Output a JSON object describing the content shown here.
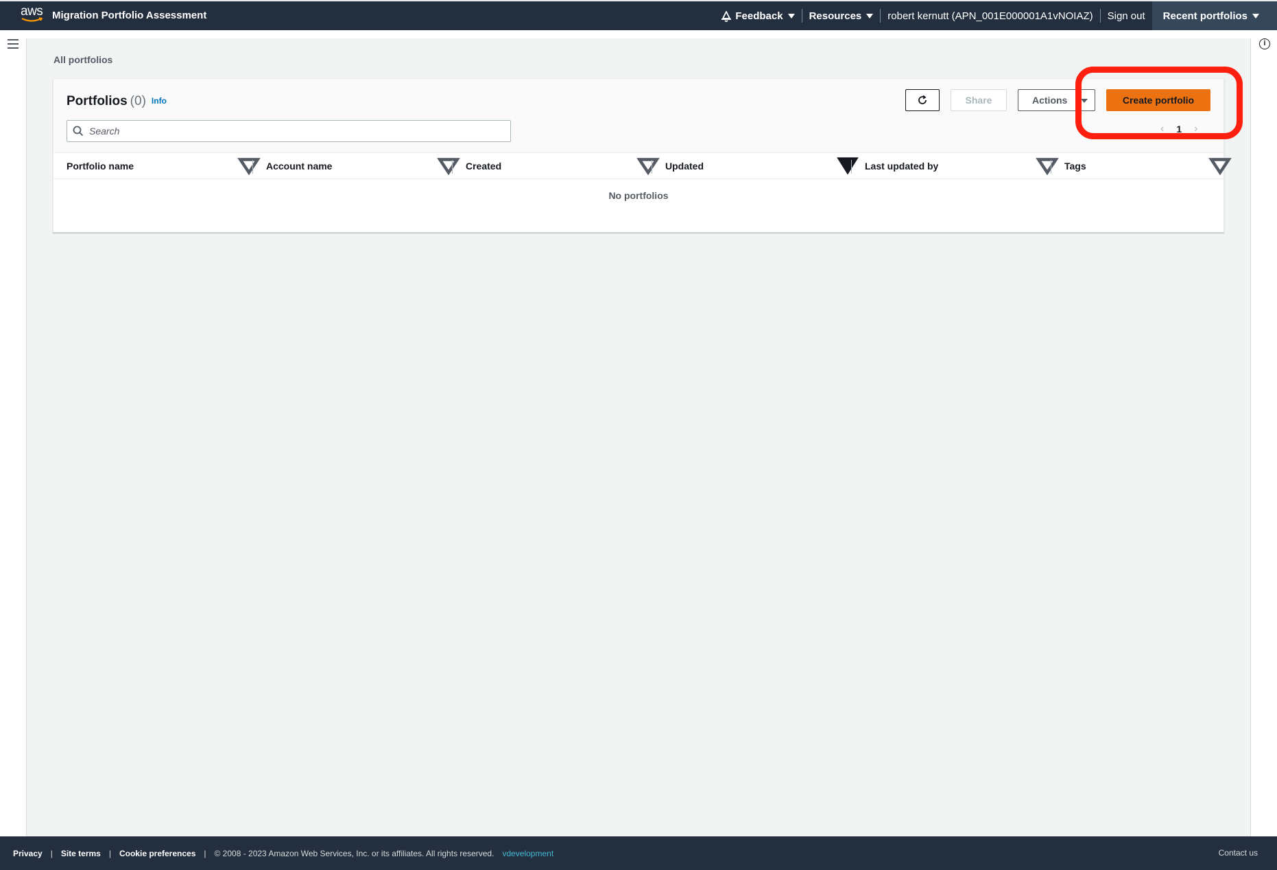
{
  "topnav": {
    "logo_text": "aws",
    "app_title": "Migration Portfolio Assessment",
    "feedback_label": "Feedback",
    "resources_label": "Resources",
    "user_label": "robert kernutt (APN_001E000001A1vNOIAZ)",
    "signout_label": "Sign out",
    "recent_label": "Recent portfolios"
  },
  "breadcrumb": "All portfolios",
  "portfolios": {
    "title": "Portfolios",
    "count": "(0)",
    "info_label": "Info",
    "search_placeholder": "Search",
    "share_label": "Share",
    "actions_label": "Actions",
    "create_label": "Create portfolio",
    "page_number": "1",
    "empty_text": "No portfolios",
    "columns": [
      "Portfolio name",
      "Account name",
      "Created",
      "Updated",
      "Last updated by",
      "Tags"
    ]
  },
  "footer": {
    "privacy": "Privacy",
    "site_terms": "Site terms",
    "cookie_prefs": "Cookie preferences",
    "copyright": "© 2008 - 2023 Amazon Web Services, Inc. or its affiliates. All rights reserved.",
    "env": "vdevelopment",
    "contact": "Contact us"
  },
  "colors": {
    "nav_bg": "#232f3e",
    "primary_button": "#ec7211",
    "annotation_highlight": "#ff1f0f",
    "link": "#0073bb"
  }
}
